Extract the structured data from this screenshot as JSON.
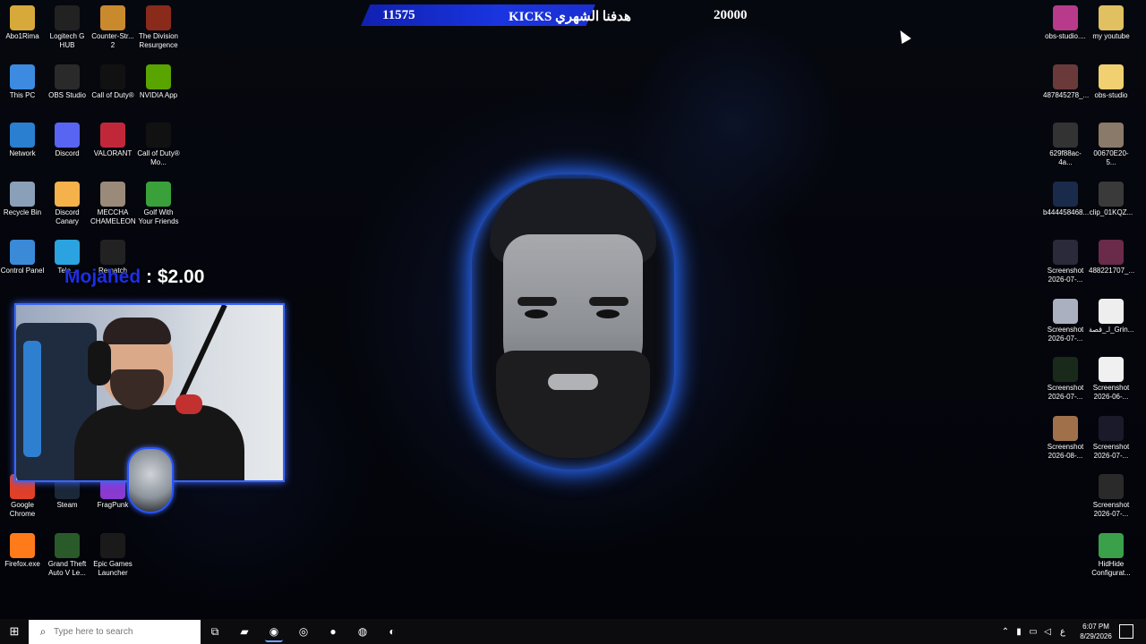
{
  "goal": {
    "current": "11575",
    "title": "هدفنا الشهري KICKS",
    "target": "20000"
  },
  "donation": {
    "name": "Mojahed",
    "separator": " : ",
    "amount": "$2.00"
  },
  "desktop_left": [
    {
      "label": "Abo1Rima",
      "icon": "folder-icon",
      "color": "#d6a93a"
    },
    {
      "label": "Logitech G HUB",
      "icon": "logitech-icon",
      "color": "#222222"
    },
    {
      "label": "Counter-Str... 2",
      "icon": "counterstrike-icon",
      "color": "#c98a2e"
    },
    {
      "label": "The Division Resurgence",
      "icon": "division-icon",
      "color": "#8a2a1a"
    },
    {
      "label": "This PC",
      "icon": "pc-icon",
      "color": "#3c8be0"
    },
    {
      "label": "OBS Studio",
      "icon": "obs-icon",
      "color": "#2a2a2a"
    },
    {
      "label": "Call of Duty®",
      "icon": "cod-icon",
      "color": "#111111"
    },
    {
      "label": "NVIDIA App",
      "icon": "nvidia-icon",
      "color": "#5aa400"
    },
    {
      "label": "Network",
      "icon": "network-icon",
      "color": "#2a7fd0"
    },
    {
      "label": "Discord",
      "icon": "discord-icon",
      "color": "#5865f2"
    },
    {
      "label": "VALORANT",
      "icon": "valorant-icon",
      "color": "#c0283a"
    },
    {
      "label": "Call of Duty® Mo...",
      "icon": "mw-icon",
      "color": "#111111"
    },
    {
      "label": "Recycle Bin",
      "icon": "recycle-bin-icon",
      "color": "#8aa0b8"
    },
    {
      "label": "Discord Canary",
      "icon": "discord-canary-icon",
      "color": "#f5b14a"
    },
    {
      "label": "MECCHA CHAMELEON",
      "icon": "meccha-icon",
      "color": "#9a8a7a"
    },
    {
      "label": "Golf With Your Friends",
      "icon": "golf-icon",
      "color": "#3aa03a"
    },
    {
      "label": "Control Panel",
      "icon": "control-panel-icon",
      "color": "#3a8ad8"
    },
    {
      "label": "Tele...",
      "icon": "telegram-icon",
      "color": "#2aa3e0"
    },
    {
      "label": "Rematch",
      "icon": "rematch-icon",
      "color": "#222222"
    },
    {
      "label": "Google Chrome",
      "icon": "chrome-icon",
      "color": "#e0402a"
    },
    {
      "label": "Steam",
      "icon": "steam-icon",
      "color": "#1b2838"
    },
    {
      "label": "FragPunk",
      "icon": "fragpunk-icon",
      "color": "#8a3ad0"
    },
    {
      "label": "Firefox.exe",
      "icon": "firefox-icon",
      "color": "#ff7a18"
    },
    {
      "label": "Grand Theft Auto V Le...",
      "icon": "gta-icon",
      "color": "#2a5a2a"
    },
    {
      "label": "Epic Games Launcher",
      "icon": "epic-icon",
      "color": "#1a1a1a"
    }
  ],
  "desktop_right": [
    {
      "label": "obs-studio....",
      "icon": "winrar-icon",
      "color": "#b83a8a"
    },
    {
      "label": "my youtube",
      "icon": "folder-icon",
      "color": "#e0c060"
    },
    {
      "label": "487845278_...",
      "icon": "image-file-icon",
      "color": "#6a3a3a"
    },
    {
      "label": "obs-studio",
      "icon": "folder-icon",
      "color": "#f0d070"
    },
    {
      "label": "629f88ac-4a...",
      "icon": "image-file-icon",
      "color": "#333333"
    },
    {
      "label": "00670E20-5...",
      "icon": "image-file-icon",
      "color": "#8a7a6a"
    },
    {
      "label": "b444458468...",
      "icon": "image-file-icon",
      "color": "#1a2a4a"
    },
    {
      "label": "clip_01KQZ...",
      "icon": "video-file-icon",
      "color": "#3a3a3a"
    },
    {
      "label": "Screenshot 2026-07-...",
      "icon": "image-file-icon",
      "color": "#2a2a3a"
    },
    {
      "label": "488221707_...",
      "icon": "image-file-icon",
      "color": "#6a2a4a"
    },
    {
      "label": "Screenshot 2026-07-...",
      "icon": "image-file-icon",
      "color": "#aab0c0"
    },
    {
      "label": "اـ_قصة_Grin...",
      "icon": "play-file-icon",
      "color": "#eeeeee"
    },
    {
      "label": "Screenshot 2026-07-...",
      "icon": "image-file-icon",
      "color": "#1a2a1a"
    },
    {
      "label": "Screenshot 2026-06-...",
      "icon": "image-file-icon",
      "color": "#f0f0f0"
    },
    {
      "label": "Screenshot 2026-08-...",
      "icon": "image-file-icon",
      "color": "#a0704a"
    },
    {
      "label": "Screenshot 2026-07-...",
      "icon": "image-file-icon",
      "color": "#1a1a2a"
    },
    {
      "label": "Screenshot 2026-07-...",
      "icon": "image-file-icon",
      "color": "#2a2a2a"
    },
    {
      "label": "HidHide Configurat...",
      "icon": "hidhide-icon",
      "color": "#3aa04a"
    }
  ],
  "taskbar": {
    "search_placeholder": "Type here to search",
    "time": "6:07 PM",
    "date": "8/29/2026",
    "lang": "ع",
    "apps": [
      {
        "name": "task-view-icon",
        "glyph": "⧉"
      },
      {
        "name": "file-explorer-icon",
        "glyph": "▰"
      },
      {
        "name": "edge-icon",
        "glyph": "◉"
      },
      {
        "name": "chrome-icon",
        "glyph": "◎"
      },
      {
        "name": "firefox-icon",
        "glyph": "●"
      },
      {
        "name": "obs-icon",
        "glyph": "◍"
      },
      {
        "name": "discord-icon",
        "glyph": "◐"
      }
    ]
  }
}
